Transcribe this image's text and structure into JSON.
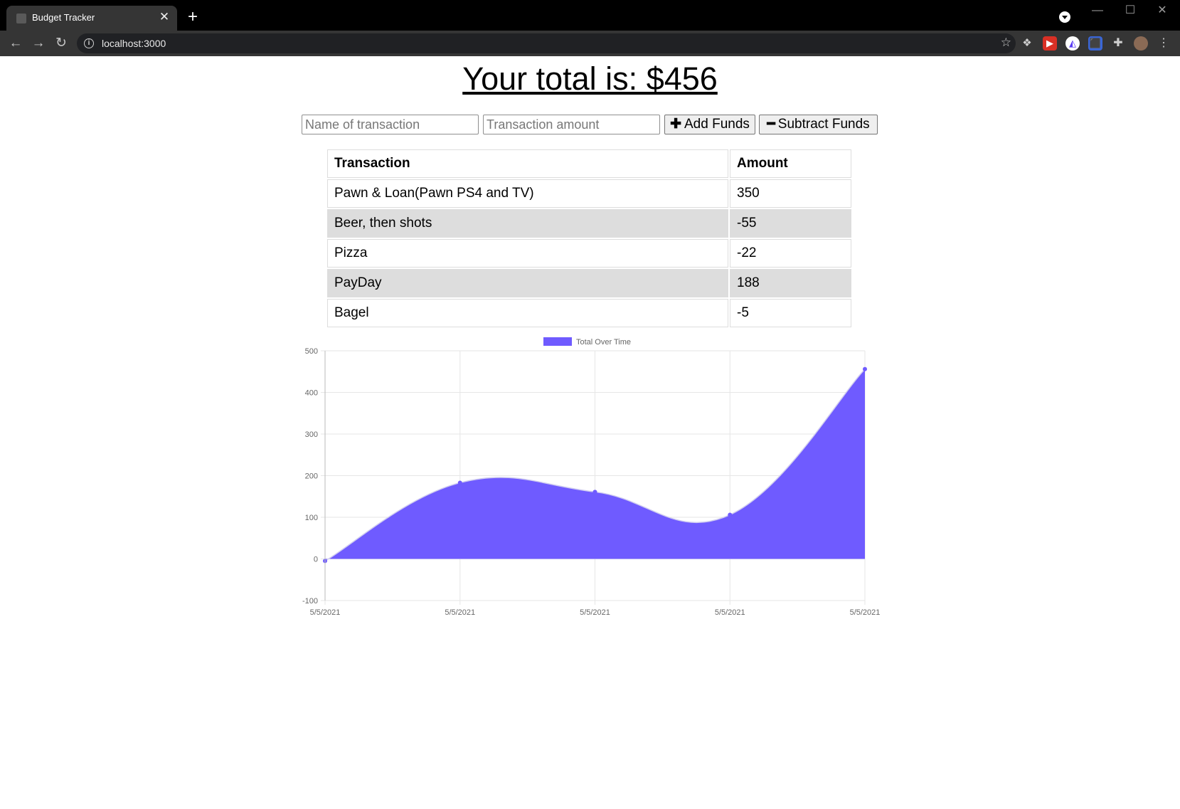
{
  "browser": {
    "tab_title": "Budget Tracker",
    "url": "localhost:3000",
    "new_tab_symbol": "+",
    "icons": [
      "back-arrow-icon",
      "forward-arrow-icon",
      "reload-icon",
      "info-icon",
      "star-icon",
      "dropbox-icon",
      "extension-icon",
      "puzzle-icon",
      "profile-icon",
      "menu-icon"
    ]
  },
  "page": {
    "title": "Your total is: $456",
    "name_placeholder": "Name of transaction",
    "amount_placeholder": "Transaction amount",
    "add_label": "Add Funds",
    "subtract_label": "Subtract Funds"
  },
  "table": {
    "headers": [
      "Transaction",
      "Amount"
    ],
    "rows": [
      [
        "Pawn & Loan(Pawn PS4 and TV)",
        "350"
      ],
      [
        "Beer, then shots",
        "-55"
      ],
      [
        "Pizza",
        "-22"
      ],
      [
        "PayDay",
        "188"
      ],
      [
        "Bagel",
        "-5"
      ]
    ]
  },
  "colors": {
    "series_fill": "#6f5bff",
    "series_stroke": "#6f5bff",
    "zebra_row": "#dddddd"
  },
  "chart_data": {
    "type": "area",
    "x": [
      "5/5/2021",
      "5/5/2021",
      "5/5/2021",
      "5/5/2021",
      "5/5/2021"
    ],
    "series": [
      {
        "name": "Total Over Time",
        "values": [
          -5,
          183,
          161,
          106,
          456
        ]
      }
    ],
    "ylim": [
      -100,
      500
    ],
    "yticks": [
      -100,
      0,
      100,
      200,
      300,
      400,
      500
    ],
    "grid": true,
    "legend": "top"
  }
}
